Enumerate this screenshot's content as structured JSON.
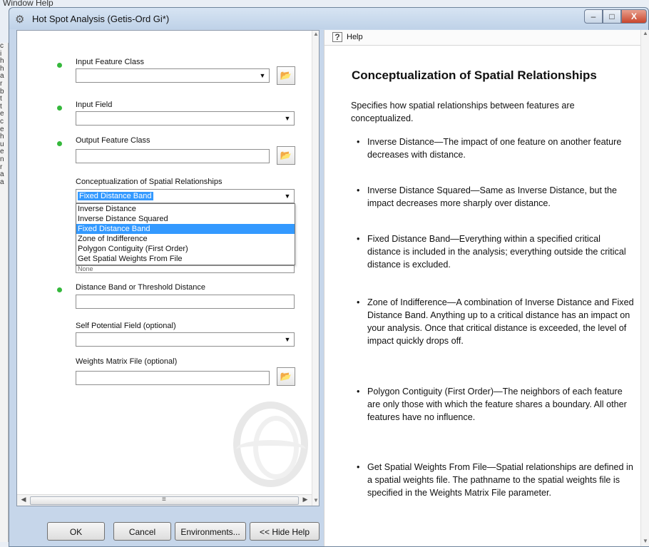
{
  "background": {
    "menu_text": "Window Help",
    "left_strip_chars": [
      "c",
      "i",
      "h",
      "h",
      "a",
      "r",
      "b",
      "t",
      "t",
      "e",
      "c",
      "e",
      "h",
      "u",
      "e",
      "n",
      "r",
      "a",
      "a"
    ]
  },
  "window": {
    "title": "Hot Spot Analysis (Getis-Ord Gi*)",
    "controls": {
      "minimize": "–",
      "maximize": "□",
      "close": "X"
    }
  },
  "form": {
    "input_feature_class": {
      "label": "Input Feature Class",
      "value": ""
    },
    "input_field": {
      "label": "Input Field",
      "value": ""
    },
    "output_feature_class": {
      "label": "Output Feature Class",
      "value": ""
    },
    "conceptualization": {
      "label": "Conceptualization of Spatial Relationships",
      "selected": "Fixed Distance Band",
      "options": [
        "Inverse Distance",
        "Inverse Distance Squared",
        "Fixed Distance Band",
        "Zone of Indifference",
        "Polygon Contiguity (First Order)",
        "Get Spatial Weights From File"
      ],
      "hidden_value": "None"
    },
    "distance_band": {
      "label": "Distance Band or Threshold Distance",
      "value": ""
    },
    "self_potential_field": {
      "label": "Self Potential Field (optional)",
      "value": ""
    },
    "weights_matrix_file": {
      "label": "Weights Matrix File (optional)",
      "value": ""
    }
  },
  "buttons": {
    "ok": "OK",
    "cancel": "Cancel",
    "environments": "Environments...",
    "hide_help": "<< Hide Help"
  },
  "help": {
    "tab_label": "Help",
    "title": "Conceptualization of Spatial Relationships",
    "intro": "Specifies how spatial relationships between features are conceptualized.",
    "items": [
      "Inverse Distance—The impact of one feature on another feature decreases with distance.",
      "Inverse Distance Squared—Same as Inverse Distance, but the impact decreases more sharply over distance.",
      "Fixed Distance Band—Everything within a specified critical distance is included in the analysis; everything outside the critical distance is excluded.",
      "Zone of Indifference—A combination of Inverse Distance and Fixed Distance Band. Anything up to a critical distance has an impact on your analysis. Once that critical distance is exceeded, the level of impact quickly drops off.",
      "Polygon Contiguity (First Order)—The neighbors of each feature are only those with which the feature shares a boundary. All other features have no influence.",
      "Get Spatial Weights From File—Spatial relationships are defined in a spatial weights file. The pathname to the spatial weights file is specified in the Weights Matrix File parameter."
    ]
  },
  "icons": {
    "app": "tool-icon",
    "browse": "folder-open-icon",
    "required": "green-dot-icon",
    "help": "help-icon",
    "dropdown": "chevron-down-icon"
  },
  "colors": {
    "required_dot": "#35b83c",
    "selection": "#3399ff",
    "window_frame": "#c6d6ea"
  }
}
